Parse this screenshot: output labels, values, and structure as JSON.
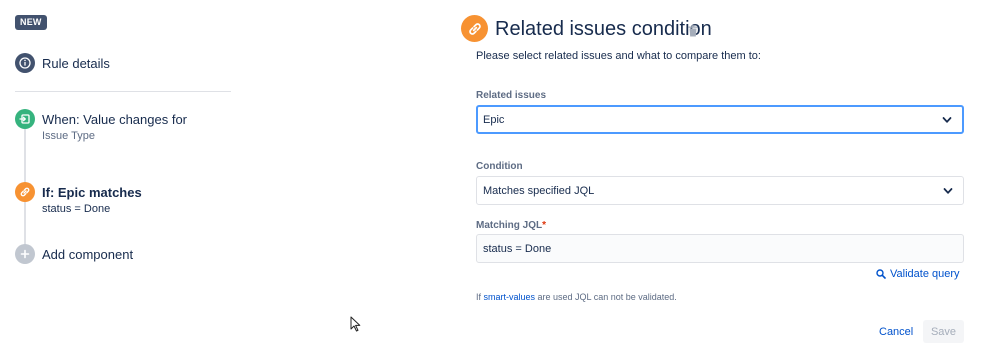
{
  "rule": {
    "badge": "NEW",
    "details_label": "Rule details",
    "trigger": {
      "title": "When: Value changes for",
      "subtitle": "Issue Type"
    },
    "condition": {
      "title": "If: Epic matches",
      "subtitle": "status = Done"
    },
    "add_component": "Add component"
  },
  "panel": {
    "title": "Related issues condition",
    "instructions": "Please select related issues and what to compare them to:",
    "related_issues": {
      "label": "Related issues",
      "value": "Epic"
    },
    "condition": {
      "label": "Condition",
      "value": "Matches specified JQL"
    },
    "matching_jql": {
      "label": "Matching JQL",
      "required_mark": "*",
      "value": "status = Done"
    },
    "validate_label": "Validate query",
    "hint": {
      "prefix": "If ",
      "link": "smart-values",
      "suffix": " are used JQL can not be validated."
    },
    "cancel_label": "Cancel",
    "save_label": "Save"
  },
  "icons": {
    "rule_details": "info-icon",
    "trigger": "trigger-icon",
    "condition": "link-icon",
    "add": "plus-icon",
    "delete": "trash-icon",
    "dropdown": "chevron-down-icon",
    "validate": "search-icon"
  },
  "colors": {
    "info": "#42526e",
    "trigger": "#36b37e",
    "condition": "#f79232",
    "add": "#c1c7d0",
    "link": "#0052cc",
    "focus": "#4c9aff"
  }
}
